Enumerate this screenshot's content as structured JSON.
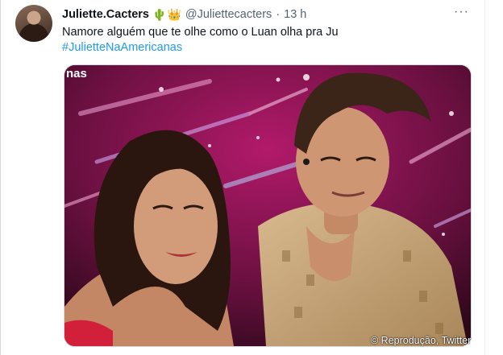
{
  "tweet": {
    "display_name": "Juliette.Cacters",
    "emoji_cactus": "🌵",
    "emoji_crown": "👑",
    "handle": "@Juliettecacters",
    "separator": "·",
    "time": "13 h",
    "more_glyph": "···",
    "text": "Namore alguém que te olhe como o Luan olha pra Ju",
    "hashtag": "#JulietteNaAmericanas"
  },
  "media": {
    "corner_text": "nas"
  },
  "watermark": {
    "text": "© Reprodução, Twitter"
  },
  "colors": {
    "accent": "#1d9bf0",
    "text_primary": "#0f1419",
    "text_secondary": "#536471"
  },
  "icons": [
    "more-options-icon"
  ]
}
